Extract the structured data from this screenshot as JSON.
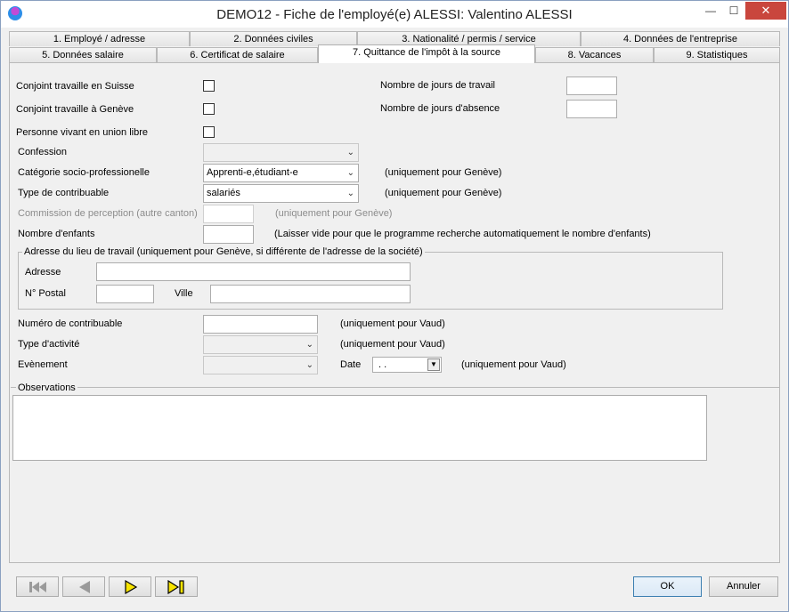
{
  "window": {
    "title": "DEMO12 - Fiche de l'employé(e) ALESSI:  Valentino ALESSI",
    "minimize": "—",
    "maximize": "☐",
    "close": "✕"
  },
  "tabs_row1": [
    {
      "label": "1. Employé / adresse"
    },
    {
      "label": "2. Données civiles"
    },
    {
      "label": "3. Nationalité / permis / service"
    },
    {
      "label": "4. Données de l'entreprise"
    }
  ],
  "tabs_row2": [
    {
      "label": "5. Données salaire"
    },
    {
      "label": "6. Certificat de salaire"
    },
    {
      "label": "7. Quittance de l'impôt à la source",
      "active": true
    },
    {
      "label": "8. Vacances"
    },
    {
      "label": "9. Statistiques"
    }
  ],
  "form": {
    "conjoint_suisse": {
      "label": "Conjoint travaille en Suisse",
      "checked": false
    },
    "conjoint_geneve": {
      "label": "Conjoint travaille à Genève",
      "checked": false
    },
    "union_libre": {
      "label": "Personne vivant en union libre",
      "checked": false
    },
    "jours_travail": {
      "label": "Nombre de jours de travail",
      "value": ""
    },
    "jours_absence": {
      "label": "Nombre de jours d'absence",
      "value": ""
    },
    "confession": {
      "label": "Confession",
      "value": ""
    },
    "categorie": {
      "label": "Catégorie socio-professionelle",
      "value": "Apprenti-e,étudiant-e",
      "note": "(uniquement pour Genève)"
    },
    "type_contribuable": {
      "label": "Type de contribuable",
      "value": "salariés",
      "note": "(uniquement pour Genève)"
    },
    "commission": {
      "label": "Commission de perception (autre canton)",
      "value": "",
      "note": "(uniquement pour Genève)"
    },
    "nombre_enfants": {
      "label": "Nombre d'enfants",
      "value": "",
      "note": "(Laisser vide pour que le programme recherche automatiquement le nombre d'enfants)"
    },
    "adresse_group": {
      "title": "Adresse du lieu de travail (uniquement pour Genève, si différente de l'adresse de la société)",
      "adresse_label": "Adresse",
      "adresse_value": "",
      "postal_label": "N° Postal",
      "postal_value": "",
      "ville_label": "Ville",
      "ville_value": ""
    },
    "numero_contribuable": {
      "label": "Numéro de contribuable",
      "value": "",
      "note": "(uniquement pour Vaud)"
    },
    "type_activite": {
      "label": "Type d'activité",
      "value": "",
      "note": "(uniquement pour Vaud)"
    },
    "evenement": {
      "label": "Evènement",
      "value": ""
    },
    "date": {
      "label": "Date",
      "value": " .  .",
      "note": "(uniquement pour Vaud)"
    },
    "observations": {
      "label": "Observations",
      "value": ""
    }
  },
  "footer": {
    "ok": "OK",
    "cancel": "Annuler"
  }
}
